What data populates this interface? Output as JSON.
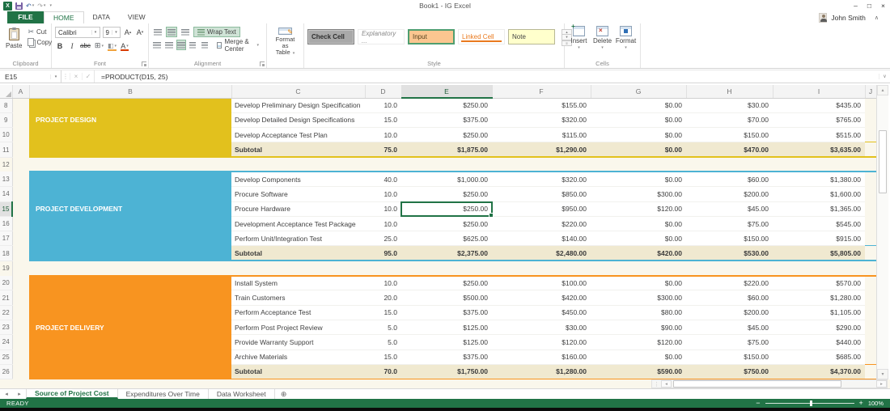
{
  "window": {
    "title": "Book1 - IG Excel"
  },
  "user": {
    "name": "John Smith"
  },
  "ribbon_tabs": [
    {
      "label": "FILE"
    },
    {
      "label": "HOME",
      "active": true
    },
    {
      "label": "DATA"
    },
    {
      "label": "VIEW"
    }
  ],
  "ribbon": {
    "clipboard": {
      "label": "Clipboard",
      "paste": "Paste",
      "cut": "Cut",
      "copy": "Copy"
    },
    "font": {
      "label": "Font",
      "family": "Calibri",
      "size": "9",
      "bold": "B",
      "italic": "I",
      "strike": "abc"
    },
    "alignment": {
      "label": "Alignment",
      "wrap": "Wrap Text",
      "merge": "Merge & Center"
    },
    "format_table": {
      "line1": "Format as",
      "line2": "Table"
    },
    "style": {
      "label": "Style",
      "items": [
        {
          "label": "Check Cell",
          "kind": "check"
        },
        {
          "label": "Explanatory ...",
          "kind": "explanatory"
        },
        {
          "label": "Input",
          "kind": "input",
          "selected": true
        },
        {
          "label": "Linked Cell",
          "kind": "linked"
        },
        {
          "label": "Note",
          "kind": "note"
        }
      ]
    },
    "cells": {
      "label": "Cells",
      "insert": "Insert",
      "delete": "Delete",
      "format": "Format"
    }
  },
  "formula_bar": {
    "cell_ref": "E15",
    "formula": "=PRODUCT(D15, 25)"
  },
  "grid": {
    "columns": [
      "A",
      "B",
      "C",
      "D",
      "E",
      "F",
      "G",
      "H",
      "I",
      "J"
    ],
    "selected_column": "E",
    "selected_row": 15,
    "selected_cell": {
      "col": "E",
      "row": 15
    },
    "sections": {
      "design": {
        "label": "PROJECT DESIGN",
        "color": "#e2c11d"
      },
      "development": {
        "label": "PROJECT DEVELOPMENT",
        "color": "#4db3d4"
      },
      "delivery": {
        "label": "PROJECT DELIVERY",
        "color": "#f89420"
      }
    },
    "rows": [
      {
        "n": 8,
        "type": "task",
        "sec": "design",
        "cells": [
          "Develop Preliminary Design Specification",
          "10.0",
          "$250.00",
          "$155.00",
          "$0.00",
          "$30.00",
          "$435.00"
        ]
      },
      {
        "n": 9,
        "type": "task",
        "sec": "design",
        "label": true,
        "cells": [
          "Develop Detailed Design Specifications",
          "15.0",
          "$375.00",
          "$320.00",
          "$0.00",
          "$70.00",
          "$765.00"
        ]
      },
      {
        "n": 10,
        "type": "task",
        "sec": "design",
        "cells": [
          "Develop Acceptance Test Plan",
          "10.0",
          "$250.00",
          "$115.00",
          "$0.00",
          "$150.00",
          "$515.00"
        ]
      },
      {
        "n": 11,
        "type": "subtotal",
        "sec": "design",
        "cells": [
          "Subtotal",
          "75.0",
          "$1,875.00",
          "$1,290.00",
          "$0.00",
          "$470.00",
          "$3,635.00"
        ]
      },
      {
        "n": 12,
        "type": "gap"
      },
      {
        "n": 13,
        "type": "task",
        "sec": "development",
        "first": true,
        "cells": [
          "Develop Components",
          "40.0",
          "$1,000.00",
          "$320.00",
          "$0.00",
          "$60.00",
          "$1,380.00"
        ]
      },
      {
        "n": 14,
        "type": "task",
        "sec": "development",
        "cells": [
          "Procure Software",
          "10.0",
          "$250.00",
          "$850.00",
          "$300.00",
          "$200.00",
          "$1,600.00"
        ]
      },
      {
        "n": 15,
        "type": "task",
        "sec": "development",
        "label": true,
        "cells": [
          "Procure Hardware",
          "10.0",
          "$250.00",
          "$950.00",
          "$120.00",
          "$45.00",
          "$1,365.00"
        ]
      },
      {
        "n": 16,
        "type": "task",
        "sec": "development",
        "cells": [
          "Development Acceptance Test Package",
          "10.0",
          "$250.00",
          "$220.00",
          "$0.00",
          "$75.00",
          "$545.00"
        ]
      },
      {
        "n": 17,
        "type": "task",
        "sec": "development",
        "cells": [
          "Perform Unit/Integration Test",
          "25.0",
          "$625.00",
          "$140.00",
          "$0.00",
          "$150.00",
          "$915.00"
        ]
      },
      {
        "n": 18,
        "type": "subtotal",
        "sec": "development",
        "cells": [
          "Subtotal",
          "95.0",
          "$2,375.00",
          "$2,480.00",
          "$420.00",
          "$530.00",
          "$5,805.00"
        ]
      },
      {
        "n": 19,
        "type": "gap"
      },
      {
        "n": 20,
        "type": "task",
        "sec": "delivery",
        "first": true,
        "cells": [
          "Install System",
          "10.0",
          "$250.00",
          "$100.00",
          "$0.00",
          "$220.00",
          "$570.00"
        ]
      },
      {
        "n": 21,
        "type": "task",
        "sec": "delivery",
        "cells": [
          "Train Customers",
          "20.0",
          "$500.00",
          "$420.00",
          "$300.00",
          "$60.00",
          "$1,280.00"
        ]
      },
      {
        "n": 22,
        "type": "task",
        "sec": "delivery",
        "cells": [
          "Perform Acceptance Test",
          "15.0",
          "$375.00",
          "$450.00",
          "$80.00",
          "$200.00",
          "$1,105.00"
        ]
      },
      {
        "n": 23,
        "type": "task",
        "sec": "delivery",
        "label": true,
        "cells": [
          "Perform Post Project Review",
          "5.0",
          "$125.00",
          "$30.00",
          "$90.00",
          "$45.00",
          "$290.00"
        ]
      },
      {
        "n": 24,
        "type": "task",
        "sec": "delivery",
        "cells": [
          "Provide Warranty Support",
          "5.0",
          "$125.00",
          "$120.00",
          "$120.00",
          "$75.00",
          "$440.00"
        ]
      },
      {
        "n": 25,
        "type": "task",
        "sec": "delivery",
        "cells": [
          "Archive Materials",
          "15.0",
          "$375.00",
          "$160.00",
          "$0.00",
          "$150.00",
          "$685.00"
        ]
      },
      {
        "n": 26,
        "type": "subtotal",
        "sec": "delivery",
        "cells": [
          "Subtotal",
          "70.0",
          "$1,750.00",
          "$1,280.00",
          "$590.00",
          "$750.00",
          "$4,370.00"
        ]
      }
    ]
  },
  "sheet_tabs": {
    "tabs": [
      {
        "label": "Source of Project Cost",
        "active": true
      },
      {
        "label": "Expenditures Over Time"
      },
      {
        "label": "Data Worksheet"
      }
    ]
  },
  "status_bar": {
    "status": "READY",
    "zoom": "100%"
  },
  "colors": {
    "accent_green": "#217346",
    "design_yellow": "#e2c11d",
    "development_blue": "#4db3d4",
    "delivery_orange": "#f89420",
    "subtotal_bg": "#f0e9d0",
    "sheet_bg": "#faf7ec",
    "input_style_bg": "#fbc690",
    "note_style_bg": "#ffffcc"
  },
  "icons": {
    "dropdown": "▾",
    "up": "▴",
    "down": "▾",
    "left": "◂",
    "right": "▸",
    "undo": "↶",
    "redo": "↷",
    "cut": "✂",
    "check": "✓",
    "close": "×",
    "minimize": "–",
    "maximize": "□",
    "chevron_up": "∧",
    "chevron_down": "∨",
    "splitter": "⋮",
    "add_sheet": "⊕",
    "minus": "−",
    "plus": "+",
    "borders": "⊞",
    "grow_font": "A",
    "shrink_font": "A",
    "font_color": "A",
    "fill_color": "◧"
  }
}
